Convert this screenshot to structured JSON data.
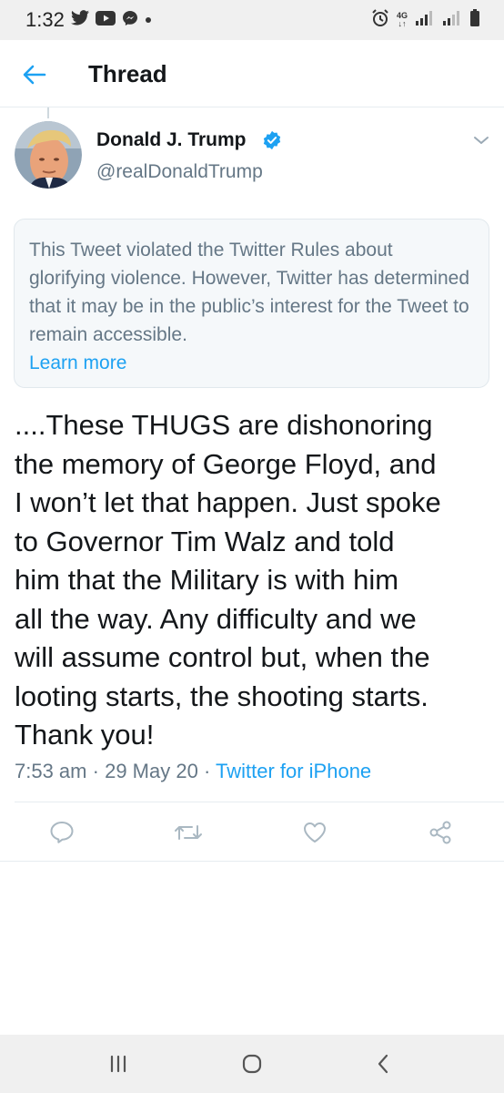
{
  "status_bar": {
    "time": "1:32",
    "left_icons": [
      "twitter-icon",
      "youtube-icon",
      "messenger-icon",
      "dot-icon"
    ],
    "right_icons": [
      "alarm-icon",
      "4g-icon",
      "signal-icon",
      "signal-icon",
      "battery-icon"
    ],
    "network_top": "4G",
    "network_bottom": "↓↑"
  },
  "header": {
    "back_icon": "arrow-left-icon",
    "title": "Thread"
  },
  "author": {
    "name": "Donald J. Trump",
    "handle": "@realDonaldTrump",
    "verified": true
  },
  "notice": {
    "text": "This Tweet violated the Twitter Rules about glorifying violence. However, Twitter has determined that it may be in the public’s interest for the Tweet to remain accessible.",
    "link": "Learn more"
  },
  "tweet": {
    "lines": [
      "....These THUGS are dishonoring",
      "the memory of George Floyd, and",
      "I won’t let that happen. Just spoke",
      "to Governor Tim Walz and told",
      "him that the Military is with him",
      "all the way. Any difficulty and we",
      "will assume control but, when the",
      "looting starts, the shooting starts.",
      "Thank you!"
    ],
    "time": "7:53 am",
    "date": "29 May 20",
    "separator": "·",
    "source": "Twitter for iPhone"
  },
  "actions": [
    "reply-icon",
    "retweet-icon",
    "like-icon",
    "share-icon"
  ],
  "colors": {
    "accent": "#1da1f2",
    "secondary_text": "#657786",
    "notice_bg": "#f5f8fa",
    "system_bar": "#f0f0f0"
  }
}
